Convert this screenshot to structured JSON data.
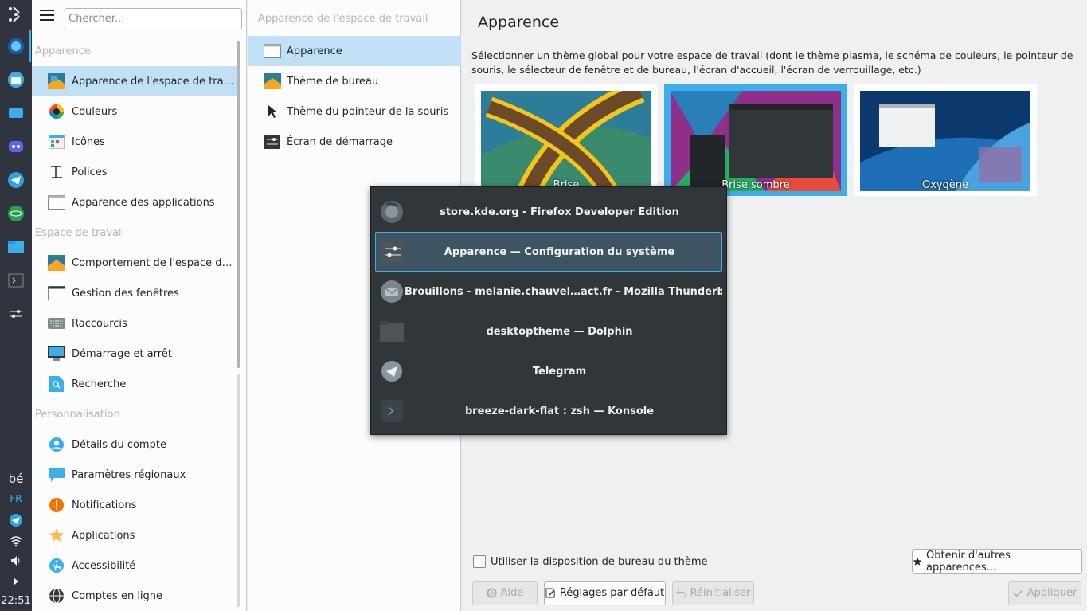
{
  "panel": {
    "lang": "bé",
    "layout": "FR",
    "clock": "22:51"
  },
  "sidebar": {
    "search_placeholder": "Chercher...",
    "sections": [
      {
        "title": "Apparence"
      },
      {
        "title": "Espace de travail"
      },
      {
        "title": "Personnalisation"
      }
    ],
    "items": [
      {
        "label": "Apparence de l'espace de travail",
        "icon": "workspace-appearance-icon"
      },
      {
        "label": "Couleurs",
        "icon": "colors-icon"
      },
      {
        "label": "Icônes",
        "icon": "icons-icon"
      },
      {
        "label": "Polices",
        "icon": "fonts-icon"
      },
      {
        "label": "Apparence des applications",
        "icon": "app-appearance-icon"
      },
      {
        "label": "Comportement de l'espace de travail",
        "icon": "workspace-behavior-icon"
      },
      {
        "label": "Gestion des fenêtres",
        "icon": "window-management-icon"
      },
      {
        "label": "Raccourcis",
        "icon": "keyboard-icon"
      },
      {
        "label": "Démarrage et arrêt",
        "icon": "startup-icon"
      },
      {
        "label": "Recherche",
        "icon": "search-icon"
      },
      {
        "label": "Détails du compte",
        "icon": "account-icon"
      },
      {
        "label": "Paramètres régionaux",
        "icon": "regional-icon"
      },
      {
        "label": "Notifications",
        "icon": "notifications-icon"
      },
      {
        "label": "Applications",
        "icon": "applications-icon"
      },
      {
        "label": "Accessibilité",
        "icon": "accessibility-icon"
      },
      {
        "label": "Comptes en ligne",
        "icon": "online-accounts-icon"
      }
    ]
  },
  "subpanel": {
    "title": "Apparence de l'espace de travail",
    "items": [
      {
        "label": "Apparence"
      },
      {
        "label": "Thème de bureau"
      },
      {
        "label": "Thème du pointeur de la souris"
      },
      {
        "label": "Écran de démarrage"
      }
    ]
  },
  "main": {
    "title": "Apparence",
    "description": "Sélectionner un thème global pour votre espace de travail (dont le thème plasma, le schéma de couleurs, le pointeur de souris, le sélecteur de fenêtre et de bureau, l'écran d'accueil, l'écran de verrouillage, etc.)",
    "themes": [
      {
        "name": "Brise"
      },
      {
        "name": "Brise sombre"
      },
      {
        "name": "Oxygène"
      }
    ],
    "checkbox_label": "Utiliser la disposition de bureau du thème",
    "get_more_label": "Obtenir d'autres apparences...",
    "help_label": "Aide",
    "defaults_label": "Réglages par défaut",
    "reset_label": "Réinitialiser",
    "apply_label": "Appliquer"
  },
  "switcher": {
    "items": [
      {
        "label": "store.kde.org - Firefox Developer Edition"
      },
      {
        "label": "Apparence — Configuration du système"
      },
      {
        "label": "Brouillons - melanie.chauvel…act.fr - Mozilla Thunderbird"
      },
      {
        "label": "desktoptheme — Dolphin"
      },
      {
        "label": "Telegram"
      },
      {
        "label": "breeze-dark-flat : zsh — Konsole"
      }
    ]
  },
  "colors": {
    "accent": "#3daee9",
    "selection": "#c2e0f5",
    "panel_bg": "#2f343f"
  }
}
